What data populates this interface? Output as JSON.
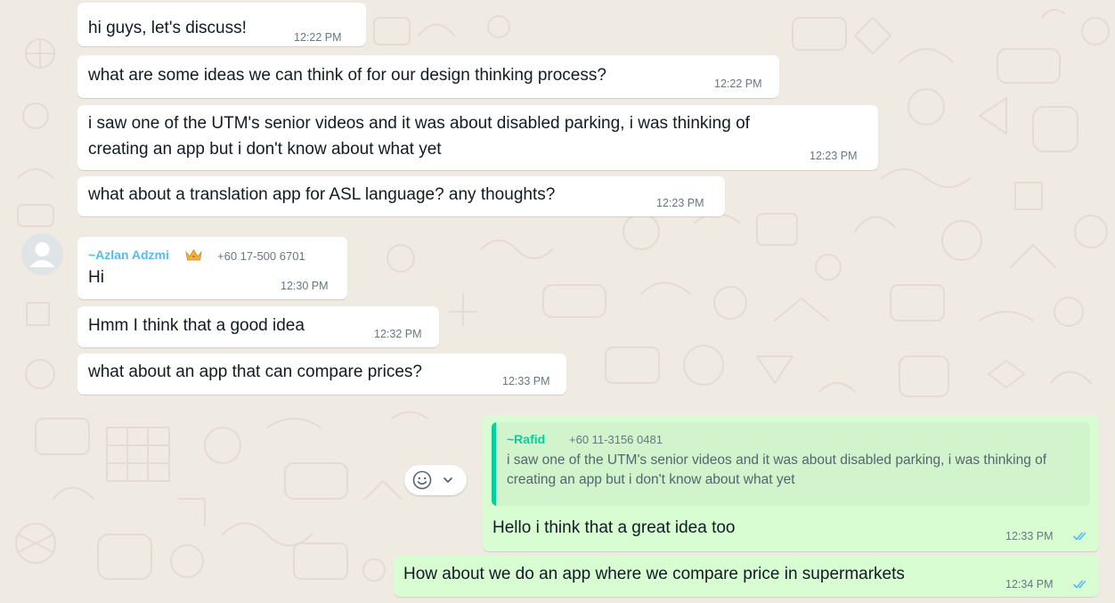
{
  "messages": [
    {
      "text": "hi guys, let's discuss!",
      "time": "12:22 PM"
    },
    {
      "text": "what are some ideas we can think of for our design thinking process?",
      "time": "12:22 PM"
    },
    {
      "line1": "i saw one of the UTM's senior videos and it was about disabled parking, i was thinking of",
      "line2": "creating an app but i don't know about what yet",
      "time": "12:23 PM"
    },
    {
      "text": "what about a translation app for ASL language? any thoughts?",
      "time": "12:23 PM"
    },
    {
      "sender": "~Azlan Adzmi",
      "phone": "+60 17-500 6701",
      "text": "Hi",
      "time": "12:30 PM"
    },
    {
      "text": "Hmm I think that a good idea",
      "time": "12:32 PM"
    },
    {
      "text": "what about an app that can compare prices?",
      "time": "12:33 PM"
    },
    {
      "quote_author": "~Rafid",
      "quote_phone": "+60 11-3156 0481",
      "quote_text": "i saw one of the UTM's senior videos and it was about disabled parking, i was thinking of creating an app but i don't know about what yet",
      "text": "Hello i think that a great idea too",
      "time": "12:33 PM"
    },
    {
      "text": "How about we do an app where we compare price in supermarkets",
      "time": "12:34 PM"
    }
  ],
  "colors": {
    "wallpaper": "#efeae2",
    "incoming_bubble": "#ffffff",
    "outgoing_bubble": "#d9fdd3",
    "sender_name": "#53bdeb",
    "quote_accent": "#06cf9c",
    "read_ticks": "#53bdeb",
    "timestamp": "#667781"
  },
  "icons": {
    "avatar": "default-user-avatar-icon",
    "reaction": "smiley-emoji-icon",
    "menu": "chevron-down-icon",
    "read_receipt": "double-check-icon",
    "admin_badge": "crown-icon"
  }
}
